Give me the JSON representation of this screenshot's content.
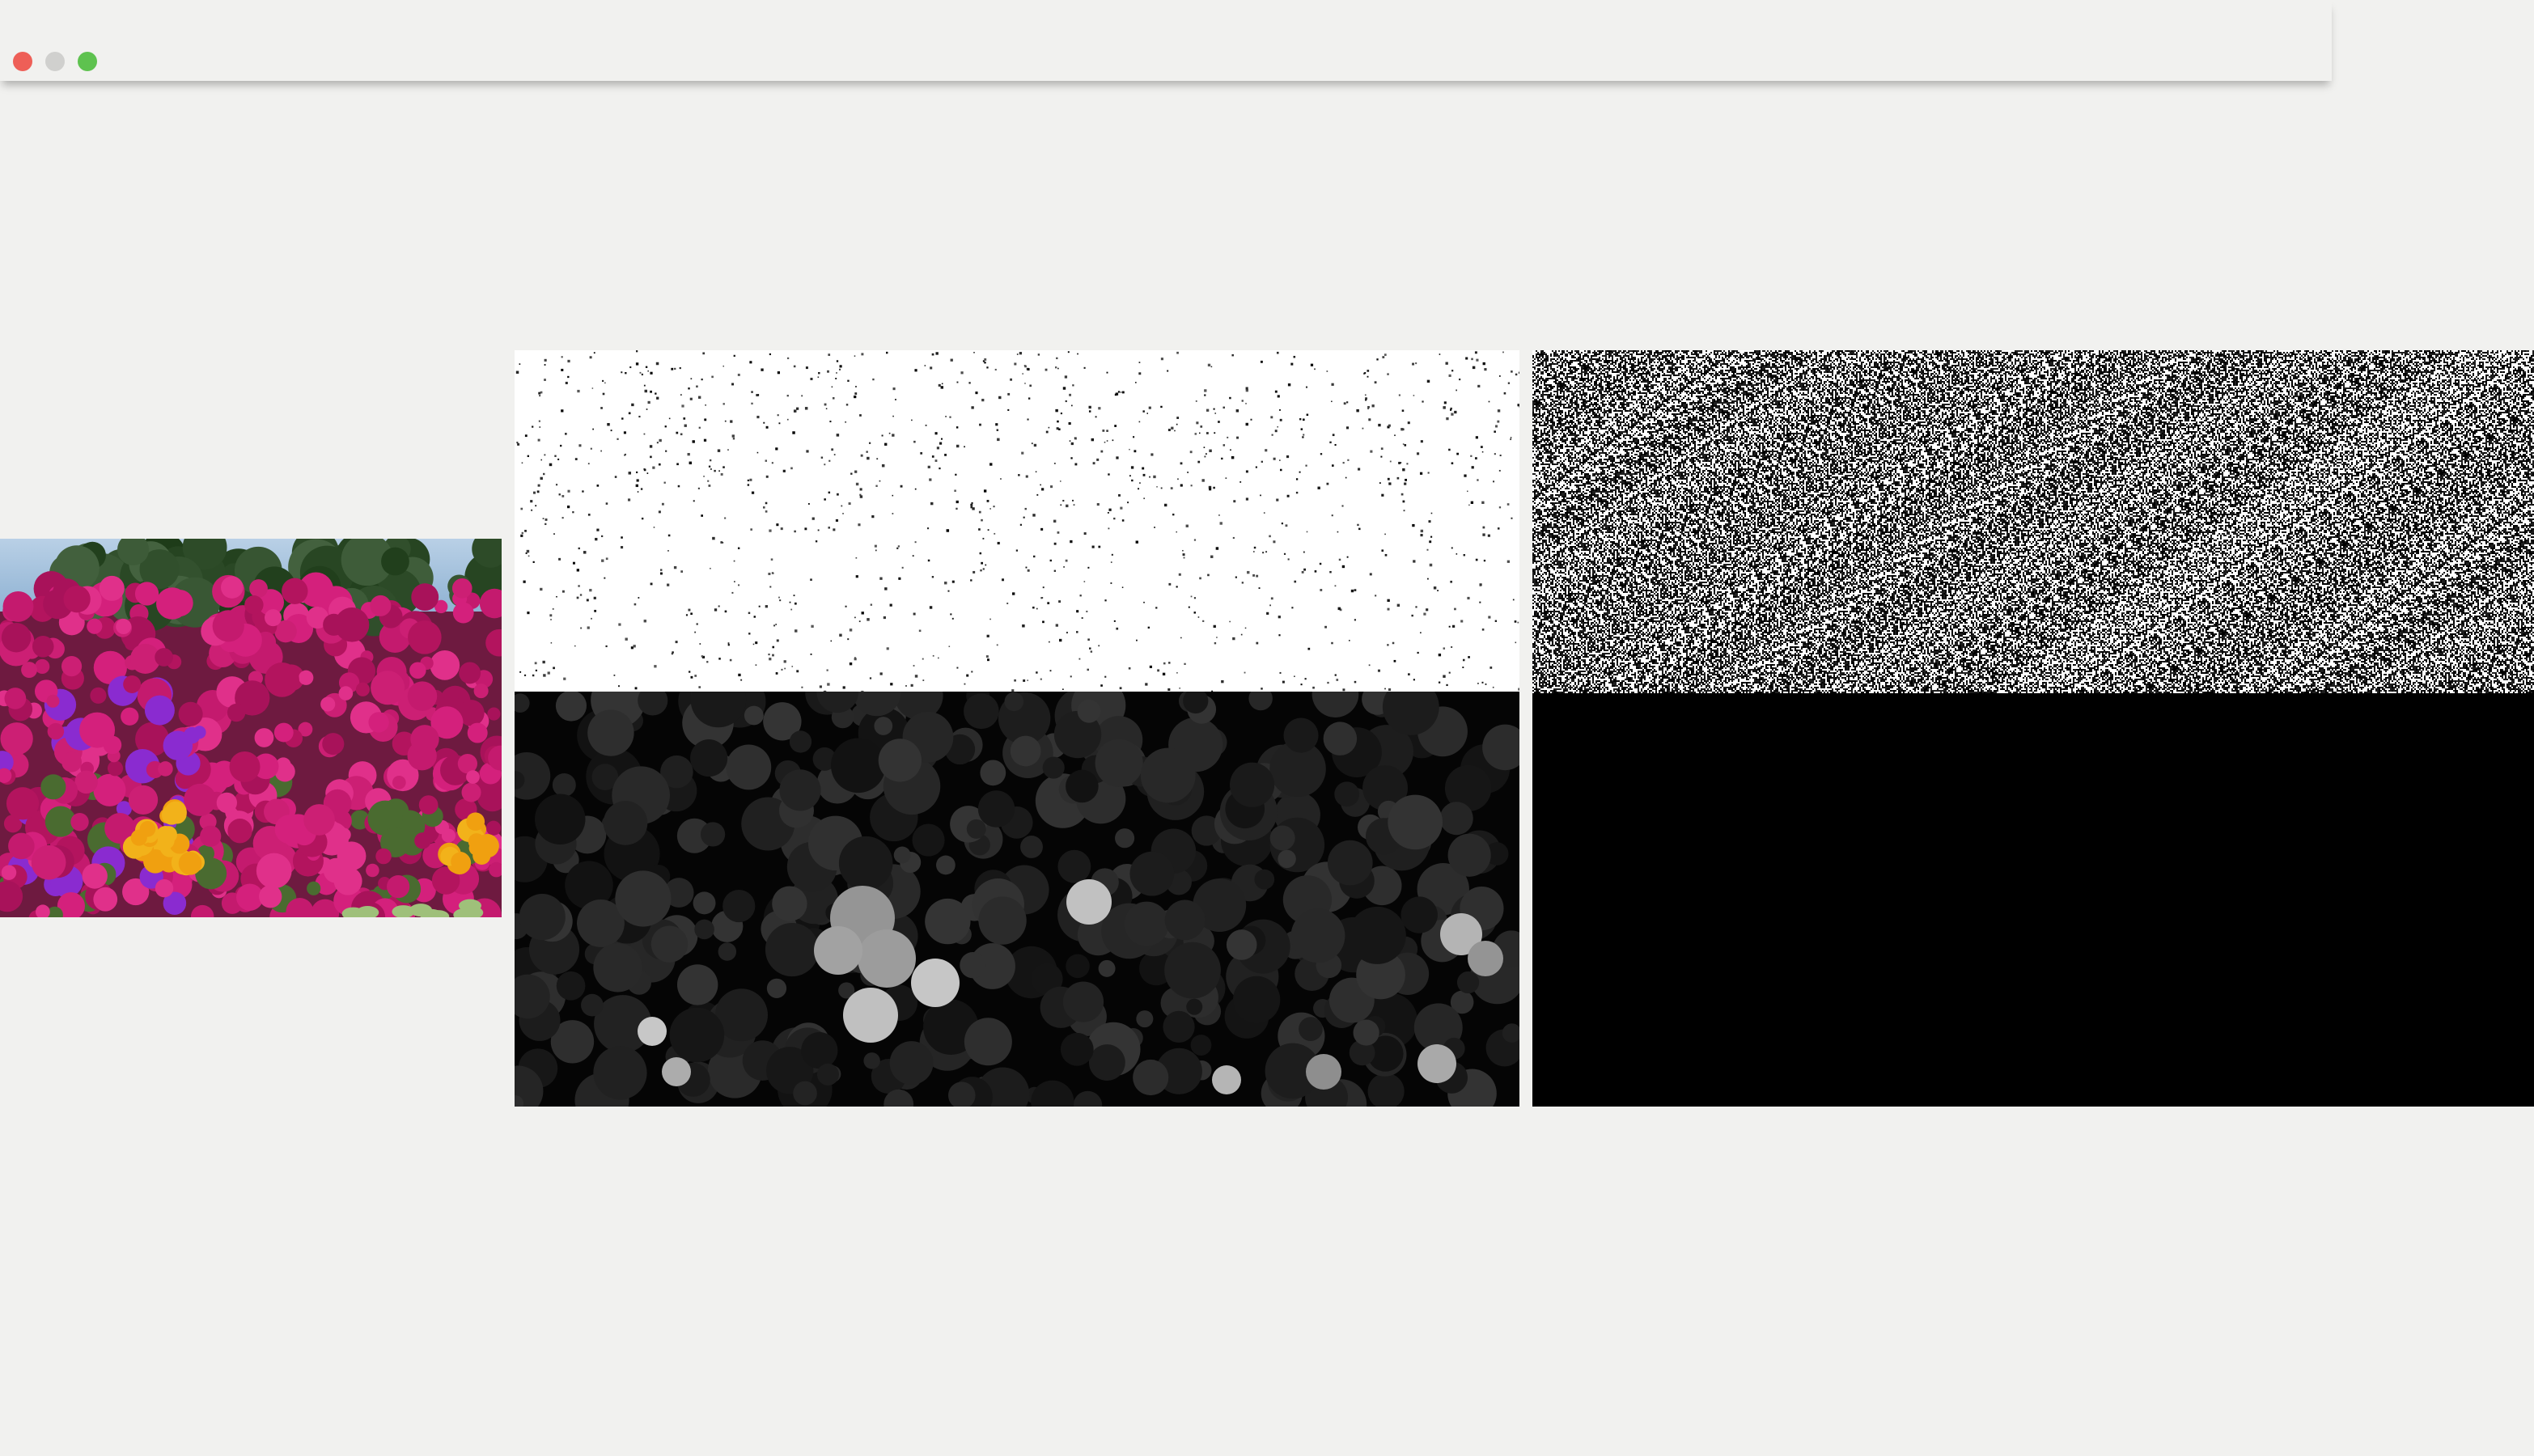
{
  "window": {
    "controls": {
      "close_color": "#ee5f57",
      "minimize_color": "#d0d0ce",
      "maximize_color": "#5ec24f",
      "close_icon": "close-dot-icon",
      "minimize_icon": "minimize-dot-icon",
      "maximize_icon": "maximize-dot-icon"
    },
    "background_color": "#f1f1ef"
  },
  "images": [
    {
      "name": "original-flowers",
      "description_colors": [
        "#c41a6e",
        "#8a2bd0",
        "#f2b21a",
        "#3c4a2a",
        "#a9c4dc"
      ]
    },
    {
      "name": "sparse-speckle-mask",
      "description_colors": [
        "#ffffff",
        "#000000"
      ]
    },
    {
      "name": "grayscale-dark-flowers",
      "description_colors": [
        "#000000",
        "#3a3a3a",
        "#b8b8b8"
      ]
    },
    {
      "name": "random-noise",
      "description_colors": [
        "#000000",
        "#ffffff"
      ]
    },
    {
      "name": "black-output",
      "description_colors": [
        "#000000"
      ]
    }
  ]
}
